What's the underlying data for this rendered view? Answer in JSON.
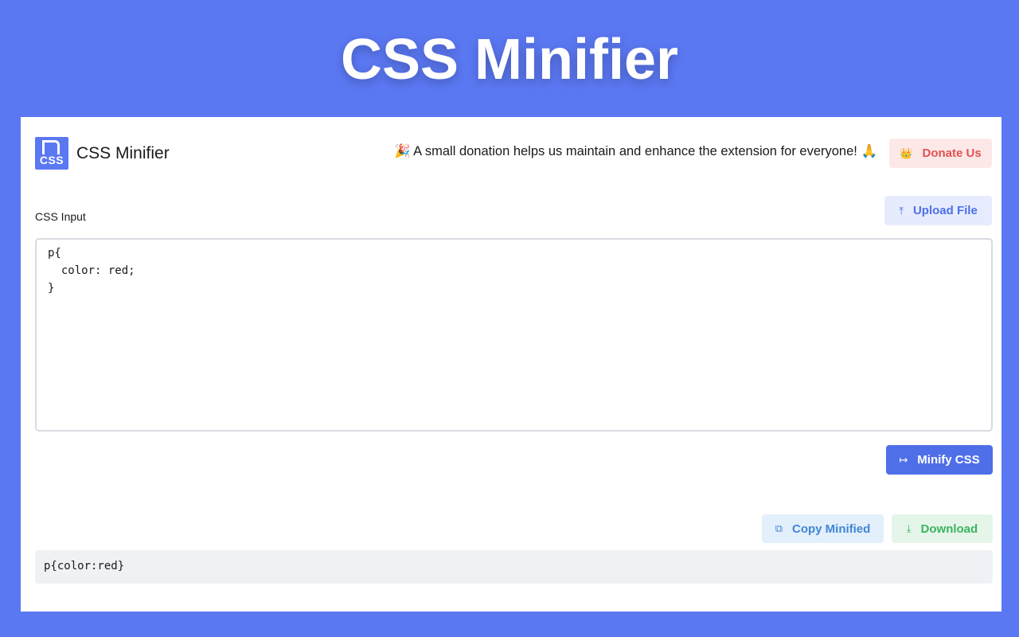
{
  "hero": {
    "title": "CSS Minifier"
  },
  "header": {
    "logo_text": "CSS",
    "app_name": "CSS Minifier",
    "donation_message": "🎉 A small donation helps us maintain and enhance the extension for everyone! 🙏",
    "donate_icon": "👑",
    "donate_label": "Donate Us"
  },
  "input_section": {
    "label": "CSS Input",
    "upload_icon": "⤒",
    "upload_label": "Upload File",
    "value": "p{\n  color: red;\n}"
  },
  "actions": {
    "minify_icon": "↦",
    "minify_label": "Minify CSS",
    "copy_icon": "⧉",
    "copy_label": "Copy Minified",
    "download_icon": "⤓",
    "download_label": "Download"
  },
  "output": {
    "value": "p{color:red}"
  },
  "colors": {
    "background": "#5b78f3",
    "primary": "#4f6fe8",
    "donate": "#e05252",
    "copy": "#3f86d6",
    "download": "#3cb45e"
  }
}
